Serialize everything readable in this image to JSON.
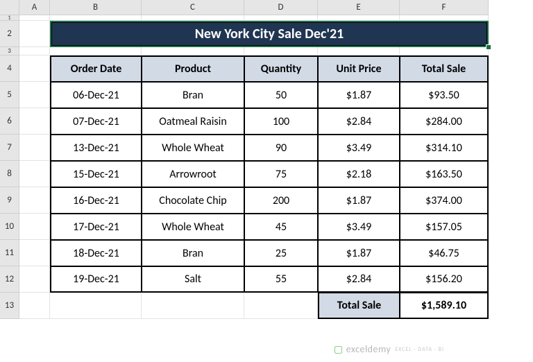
{
  "columns": [
    "A",
    "B",
    "C",
    "D",
    "E",
    "F"
  ],
  "rows": [
    "1",
    "2",
    "3",
    "4",
    "5",
    "6",
    "7",
    "8",
    "9",
    "10",
    "11",
    "12",
    "13"
  ],
  "title": "New York City Sale Dec'21",
  "headers": {
    "order_date": "Order Date",
    "product": "Product",
    "quantity": "Quantity",
    "unit_price": "Unit Price",
    "total_sale": "Total Sale"
  },
  "data": [
    {
      "order_date": "06-Dec-21",
      "product": "Bran",
      "quantity": "50",
      "unit_price": "$1.87",
      "total_sale": "$93.50"
    },
    {
      "order_date": "07-Dec-21",
      "product": "Oatmeal Raisin",
      "quantity": "100",
      "unit_price": "$2.84",
      "total_sale": "$284.00"
    },
    {
      "order_date": "13-Dec-21",
      "product": "Whole Wheat",
      "quantity": "90",
      "unit_price": "$3.49",
      "total_sale": "$314.10"
    },
    {
      "order_date": "15-Dec-21",
      "product": "Arrowroot",
      "quantity": "75",
      "unit_price": "$2.18",
      "total_sale": "$163.50"
    },
    {
      "order_date": "16-Dec-21",
      "product": "Chocolate Chip",
      "quantity": "200",
      "unit_price": "$1.87",
      "total_sale": "$374.00"
    },
    {
      "order_date": "17-Dec-21",
      "product": "Whole Wheat",
      "quantity": "45",
      "unit_price": "$3.49",
      "total_sale": "$157.05"
    },
    {
      "order_date": "18-Dec-21",
      "product": "Bran",
      "quantity": "25",
      "unit_price": "$1.87",
      "total_sale": "$46.75"
    },
    {
      "order_date": "19-Dec-21",
      "product": "Salt",
      "quantity": "55",
      "unit_price": "$2.84",
      "total_sale": "$156.20"
    }
  ],
  "footer": {
    "label": "Total Sale",
    "value": "$1,589.10"
  },
  "watermark": {
    "text": "exceldemy",
    "sub": "EXCEL · DATA · BI"
  },
  "chart_data": {
    "type": "table",
    "title": "New York City Sale Dec'21",
    "columns": [
      "Order Date",
      "Product",
      "Quantity",
      "Unit Price",
      "Total Sale"
    ],
    "rows": [
      [
        "06-Dec-21",
        "Bran",
        50,
        1.87,
        93.5
      ],
      [
        "07-Dec-21",
        "Oatmeal Raisin",
        100,
        2.84,
        284.0
      ],
      [
        "13-Dec-21",
        "Whole Wheat",
        90,
        3.49,
        314.1
      ],
      [
        "15-Dec-21",
        "Arrowroot",
        75,
        2.18,
        163.5
      ],
      [
        "16-Dec-21",
        "Chocolate Chip",
        200,
        1.87,
        374.0
      ],
      [
        "17-Dec-21",
        "Whole Wheat",
        45,
        3.49,
        157.05
      ],
      [
        "18-Dec-21",
        "Bran",
        25,
        1.87,
        46.75
      ],
      [
        "19-Dec-21",
        "Salt",
        55,
        2.84,
        156.2
      ]
    ],
    "total": 1589.1
  }
}
